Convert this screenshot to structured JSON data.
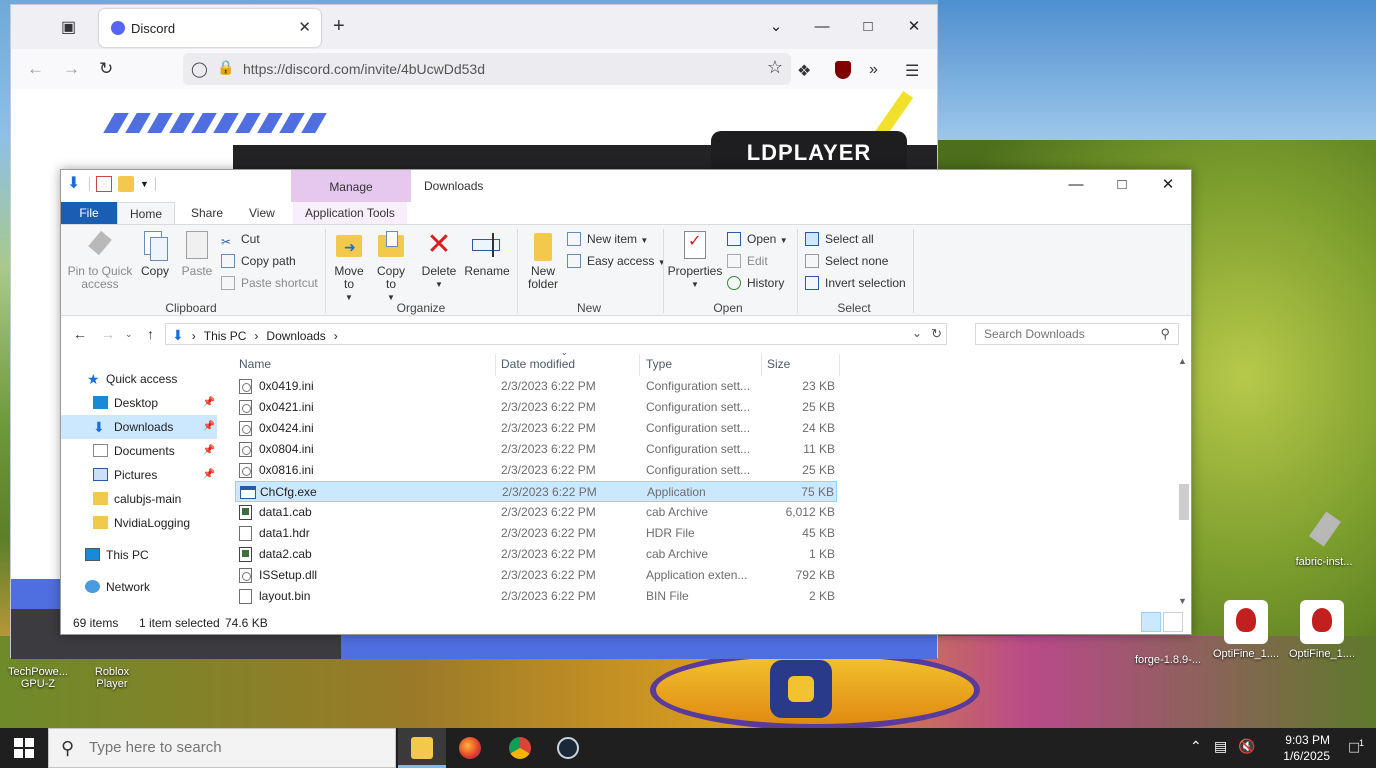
{
  "browser": {
    "tab_title": "Discord",
    "url": "https://discord.com/invite/4bUcwDd53d",
    "ad_brand": "LDPLAYER"
  },
  "desktop": {
    "icons": [
      {
        "label": "fabric-inst..."
      },
      {
        "label": "forge-1.8.9-..."
      },
      {
        "label": "OptiFine_1...."
      },
      {
        "label": "OptiFine_1...."
      },
      {
        "label": "TechPowe...\nGPU-Z"
      },
      {
        "label": "Roblox\nPlayer"
      }
    ]
  },
  "explorer": {
    "manage_label": "Manage",
    "window_title": "Downloads",
    "ribbon_tabs": [
      "File",
      "Home",
      "Share",
      "View",
      "Application Tools"
    ],
    "clipboard": {
      "pin": "Pin to Quick access",
      "copy": "Copy",
      "paste": "Paste",
      "cut": "Cut",
      "copy_path": "Copy path",
      "paste_shortcut": "Paste shortcut",
      "label": "Clipboard"
    },
    "organize": {
      "move_to": "Move to",
      "copy_to": "Copy to",
      "delete": "Delete",
      "rename": "Rename",
      "label": "Organize"
    },
    "new": {
      "new_folder": "New folder",
      "new_item": "New item",
      "easy_access": "Easy access",
      "label": "New"
    },
    "open": {
      "properties": "Properties",
      "open": "Open",
      "edit": "Edit",
      "history": "History",
      "label": "Open"
    },
    "select": {
      "select_all": "Select all",
      "select_none": "Select none",
      "invert": "Invert selection",
      "label": "Select"
    },
    "breadcrumb": [
      "This PC",
      "Downloads"
    ],
    "search_placeholder": "Search Downloads",
    "nav": [
      {
        "label": "Quick access",
        "pinned": false
      },
      {
        "label": "Desktop",
        "pinned": true
      },
      {
        "label": "Downloads",
        "pinned": true
      },
      {
        "label": "Documents",
        "pinned": true
      },
      {
        "label": "Pictures",
        "pinned": true
      },
      {
        "label": "calubjs-main",
        "pinned": false
      },
      {
        "label": "NvidiaLogging",
        "pinned": false
      },
      {
        "label": "This PC",
        "pinned": false
      },
      {
        "label": "Network",
        "pinned": false
      }
    ],
    "columns": {
      "name": "Name",
      "date": "Date modified",
      "type": "Type",
      "size": "Size"
    },
    "files": [
      {
        "name": "0x0419.ini",
        "date": "2/3/2023 6:22 PM",
        "type": "Configuration sett...",
        "size": "23 KB",
        "icon": "cfg"
      },
      {
        "name": "0x0421.ini",
        "date": "2/3/2023 6:22 PM",
        "type": "Configuration sett...",
        "size": "25 KB",
        "icon": "cfg"
      },
      {
        "name": "0x0424.ini",
        "date": "2/3/2023 6:22 PM",
        "type": "Configuration sett...",
        "size": "24 KB",
        "icon": "cfg"
      },
      {
        "name": "0x0804.ini",
        "date": "2/3/2023 6:22 PM",
        "type": "Configuration sett...",
        "size": "11 KB",
        "icon": "cfg"
      },
      {
        "name": "0x0816.ini",
        "date": "2/3/2023 6:22 PM",
        "type": "Configuration sett...",
        "size": "25 KB",
        "icon": "cfg"
      },
      {
        "name": "ChCfg.exe",
        "date": "2/3/2023 6:22 PM",
        "type": "Application",
        "size": "75 KB",
        "icon": "app",
        "selected": true
      },
      {
        "name": "data1.cab",
        "date": "2/3/2023 6:22 PM",
        "type": "cab Archive",
        "size": "6,012 KB",
        "icon": "cab"
      },
      {
        "name": "data1.hdr",
        "date": "2/3/2023 6:22 PM",
        "type": "HDR File",
        "size": "45 KB",
        "icon": "file"
      },
      {
        "name": "data2.cab",
        "date": "2/3/2023 6:22 PM",
        "type": "cab Archive",
        "size": "1 KB",
        "icon": "cab"
      },
      {
        "name": "ISSetup.dll",
        "date": "2/3/2023 6:22 PM",
        "type": "Application exten...",
        "size": "792 KB",
        "icon": "cfg"
      },
      {
        "name": "layout.bin",
        "date": "2/3/2023 6:22 PM",
        "type": "BIN File",
        "size": "2 KB",
        "icon": "file"
      }
    ],
    "status": {
      "items": "69 items",
      "selected": "1 item selected",
      "size": "74.6 KB"
    }
  },
  "taskbar": {
    "search_placeholder": "Type here to search",
    "time": "9:03 PM",
    "date": "1/6/2025",
    "notifications": "1"
  }
}
